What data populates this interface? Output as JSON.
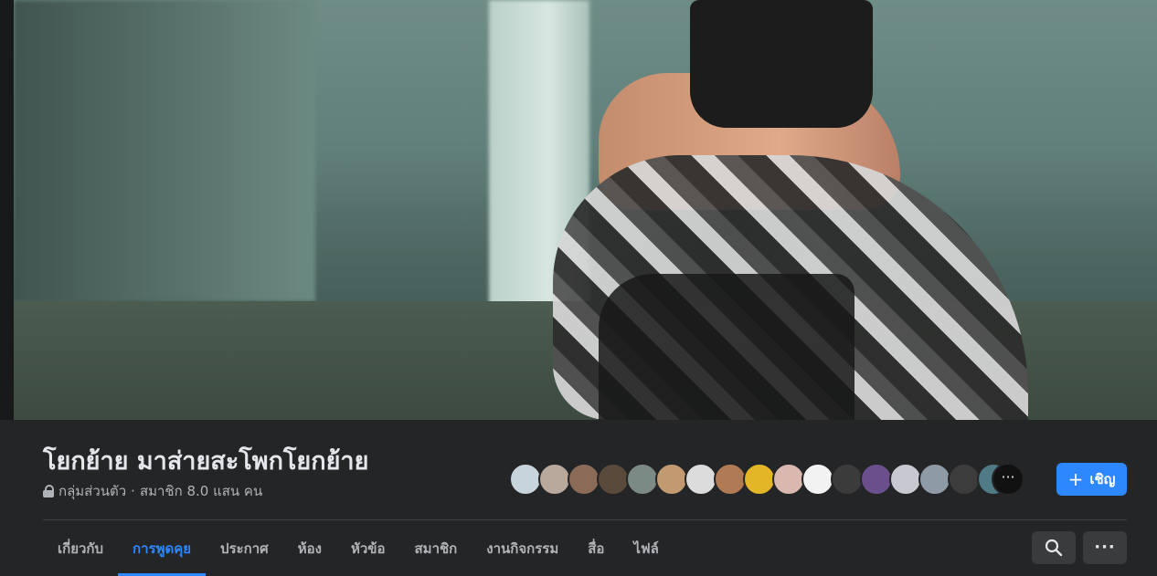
{
  "group": {
    "title": "โยกย้าย มาส่ายสะโพกโยกย้าย",
    "privacy": "กลุ่มส่วนตัว",
    "separator": "·",
    "members_text": "สมาชิก 8.0 แสน คน"
  },
  "member_avatars": [
    {
      "color": "#c7d4dc"
    },
    {
      "color": "#b9a89c"
    },
    {
      "color": "#8a6b58"
    },
    {
      "color": "#5a4a3c"
    },
    {
      "color": "#7c8a86"
    },
    {
      "color": "#c29a72"
    },
    {
      "color": "#dcdcdc"
    },
    {
      "color": "#b07a55"
    },
    {
      "color": "#e3b628"
    },
    {
      "color": "#d9b8b0"
    },
    {
      "color": "#f2f2f2"
    },
    {
      "color": "#3b3b3b"
    },
    {
      "color": "#6a4f8c"
    },
    {
      "color": "#c8c8d0"
    },
    {
      "color": "#8e9aa6"
    },
    {
      "color": "#3c3c3c"
    },
    {
      "color": "#4f7a86"
    }
  ],
  "more_members_label": "···",
  "invite_button": {
    "icon": "plus-icon",
    "label": "เชิญ"
  },
  "tabs": [
    {
      "label": "เกี่ยวกับ",
      "active": false
    },
    {
      "label": "การพูดคุย",
      "active": true
    },
    {
      "label": "ประกาศ",
      "active": false
    },
    {
      "label": "ห้อง",
      "active": false
    },
    {
      "label": "หัวข้อ",
      "active": false
    },
    {
      "label": "สมาชิก",
      "active": false
    },
    {
      "label": "งานกิจกรรม",
      "active": false
    },
    {
      "label": "สื่อ",
      "active": false
    },
    {
      "label": "ไฟล์",
      "active": false
    }
  ],
  "actions": {
    "search_icon": "search-icon",
    "more_label": "···"
  },
  "colors": {
    "accent": "#2d88ff",
    "header_bg": "#242526"
  }
}
